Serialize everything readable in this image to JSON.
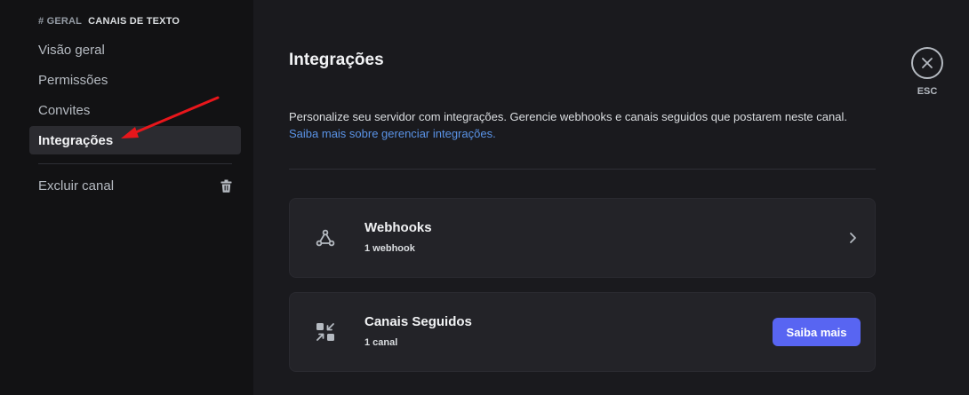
{
  "sidebar": {
    "category_prefix": "# GERAL",
    "category_label": "CANAIS DE TEXTO",
    "items": [
      {
        "label": "Visão geral"
      },
      {
        "label": "Permissões"
      },
      {
        "label": "Convites"
      },
      {
        "label": "Integrações",
        "active": true
      }
    ],
    "delete_label": "Excluir canal"
  },
  "main": {
    "title": "Integrações",
    "description": "Personalize seu servidor com integrações. Gerencie webhooks e canais seguidos que postarem neste canal.",
    "learn_more_link": "Saiba mais sobre gerenciar integrações.",
    "cards": [
      {
        "title": "Webhooks",
        "subtitle": "1 webhook",
        "icon": "webhook-icon"
      },
      {
        "title": "Canais Seguidos",
        "subtitle": "1 canal",
        "icon": "follow-icon",
        "button_label": "Saiba mais"
      }
    ]
  },
  "close": {
    "label": "ESC"
  },
  "colors": {
    "accent": "#5865f2",
    "link": "#5a93e6",
    "annotation_arrow": "#e8161b",
    "sidebar_bg": "#121214",
    "content_bg": "#1a1a1e"
  }
}
